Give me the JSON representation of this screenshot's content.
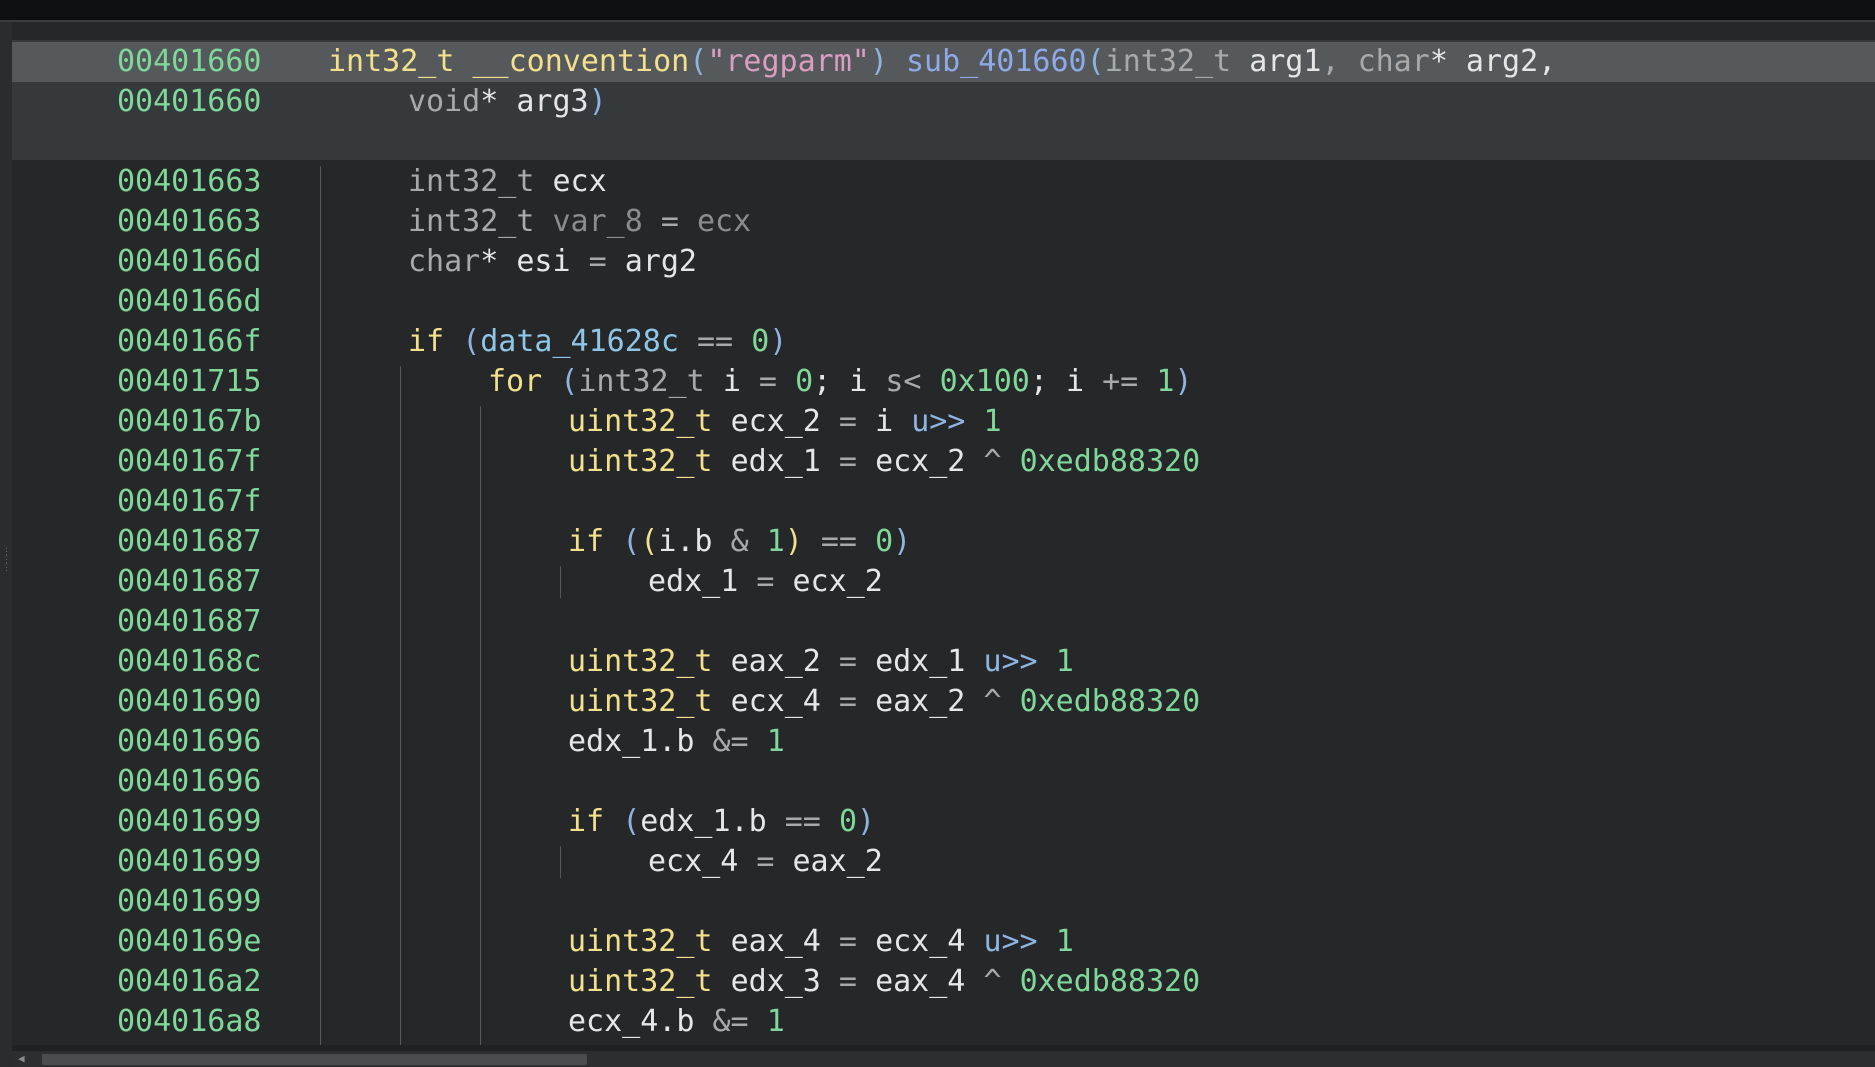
{
  "editor": {
    "lines": [
      {
        "addr": "00401660",
        "indent": 0,
        "tokens": [
          [
            "ytype",
            "int32_t "
          ],
          [
            "fname",
            "__convention"
          ],
          [
            "punc",
            "("
          ],
          [
            "str",
            "\"regparm\""
          ],
          [
            "punc",
            ") "
          ],
          [
            "func",
            "sub_401660"
          ],
          [
            "punc",
            "("
          ],
          [
            "type",
            "int32_t "
          ],
          [
            "var",
            "arg1"
          ],
          [
            "op",
            ", "
          ],
          [
            "type",
            "char"
          ],
          [
            "var",
            "* arg2,"
          ]
        ]
      },
      {
        "addr": "00401660",
        "indent": 1,
        "tokens": [
          [
            "type",
            "void"
          ],
          [
            "var",
            "* arg3"
          ],
          [
            "punc",
            ")"
          ]
        ]
      },
      {
        "addr": "",
        "indent": 0,
        "tokens": []
      },
      {
        "addr": "00401663",
        "indent": 1,
        "tokens": [
          [
            "type",
            "int32_t "
          ],
          [
            "var",
            "ecx"
          ]
        ]
      },
      {
        "addr": "00401663",
        "indent": 1,
        "tokens": [
          [
            "type",
            "int32_t "
          ],
          [
            "dim",
            "var_8"
          ],
          [
            "op",
            " = "
          ],
          [
            "dim",
            "ecx"
          ]
        ]
      },
      {
        "addr": "0040166d",
        "indent": 1,
        "tokens": [
          [
            "type",
            "char"
          ],
          [
            "var",
            "* esi"
          ],
          [
            "op",
            " = "
          ],
          [
            "var",
            "arg2"
          ]
        ]
      },
      {
        "addr": "0040166d",
        "indent": 1,
        "tokens": []
      },
      {
        "addr": "0040166f",
        "indent": 1,
        "tokens": [
          [
            "kw",
            "if "
          ],
          [
            "punc",
            "("
          ],
          [
            "data",
            "data_41628c"
          ],
          [
            "op",
            " == "
          ],
          [
            "num",
            "0"
          ],
          [
            "punc",
            ")"
          ]
        ]
      },
      {
        "addr": "00401715",
        "indent": 2,
        "tokens": [
          [
            "kw",
            "for "
          ],
          [
            "punc",
            "("
          ],
          [
            "type",
            "int32_t "
          ],
          [
            "var",
            "i"
          ],
          [
            "op",
            " = "
          ],
          [
            "num",
            "0"
          ],
          [
            "var",
            "; i "
          ],
          [
            "op",
            "s< "
          ],
          [
            "num",
            "0x100"
          ],
          [
            "var",
            "; i "
          ],
          [
            "op",
            "+= "
          ],
          [
            "num",
            "1"
          ],
          [
            "punc",
            ")"
          ]
        ]
      },
      {
        "addr": "0040167b",
        "indent": 3,
        "tokens": [
          [
            "ytype",
            "uint32_t "
          ],
          [
            "var",
            "ecx_2"
          ],
          [
            "op",
            " = "
          ],
          [
            "var",
            "i "
          ],
          [
            "punc",
            "u>> "
          ],
          [
            "num",
            "1"
          ]
        ]
      },
      {
        "addr": "0040167f",
        "indent": 3,
        "tokens": [
          [
            "ytype",
            "uint32_t "
          ],
          [
            "var",
            "edx_1"
          ],
          [
            "op",
            " = "
          ],
          [
            "var",
            "ecx_2 "
          ],
          [
            "op",
            "^ "
          ],
          [
            "num",
            "0xedb88320"
          ]
        ]
      },
      {
        "addr": "0040167f",
        "indent": 3,
        "tokens": []
      },
      {
        "addr": "00401687",
        "indent": 3,
        "tokens": [
          [
            "kw",
            "if "
          ],
          [
            "punc",
            "("
          ],
          [
            "pcall",
            "("
          ],
          [
            "var",
            "i.b "
          ],
          [
            "op",
            "& "
          ],
          [
            "num",
            "1"
          ],
          [
            "pcall",
            ")"
          ],
          [
            "op",
            " == "
          ],
          [
            "num",
            "0"
          ],
          [
            "punc",
            ")"
          ]
        ]
      },
      {
        "addr": "00401687",
        "indent": 4,
        "tokens": [
          [
            "var",
            "edx_1"
          ],
          [
            "op",
            " = "
          ],
          [
            "var",
            "ecx_2"
          ]
        ]
      },
      {
        "addr": "00401687",
        "indent": 3,
        "tokens": []
      },
      {
        "addr": "0040168c",
        "indent": 3,
        "tokens": [
          [
            "ytype",
            "uint32_t "
          ],
          [
            "var",
            "eax_2"
          ],
          [
            "op",
            " = "
          ],
          [
            "var",
            "edx_1 "
          ],
          [
            "punc",
            "u>> "
          ],
          [
            "num",
            "1"
          ]
        ]
      },
      {
        "addr": "00401690",
        "indent": 3,
        "tokens": [
          [
            "ytype",
            "uint32_t "
          ],
          [
            "var",
            "ecx_4"
          ],
          [
            "op",
            " = "
          ],
          [
            "var",
            "eax_2 "
          ],
          [
            "op",
            "^ "
          ],
          [
            "num",
            "0xedb88320"
          ]
        ]
      },
      {
        "addr": "00401696",
        "indent": 3,
        "tokens": [
          [
            "var",
            "edx_1.b "
          ],
          [
            "op",
            "&= "
          ],
          [
            "num",
            "1"
          ]
        ]
      },
      {
        "addr": "00401696",
        "indent": 3,
        "tokens": []
      },
      {
        "addr": "00401699",
        "indent": 3,
        "tokens": [
          [
            "kw",
            "if "
          ],
          [
            "punc",
            "("
          ],
          [
            "var",
            "edx_1.b"
          ],
          [
            "op",
            " == "
          ],
          [
            "num",
            "0"
          ],
          [
            "punc",
            ")"
          ]
        ]
      },
      {
        "addr": "00401699",
        "indent": 4,
        "tokens": [
          [
            "var",
            "ecx_4"
          ],
          [
            "op",
            " = "
          ],
          [
            "var",
            "eax_2"
          ]
        ]
      },
      {
        "addr": "00401699",
        "indent": 3,
        "tokens": []
      },
      {
        "addr": "0040169e",
        "indent": 3,
        "tokens": [
          [
            "ytype",
            "uint32_t "
          ],
          [
            "var",
            "eax_4"
          ],
          [
            "op",
            " = "
          ],
          [
            "var",
            "ecx_4 "
          ],
          [
            "punc",
            "u>> "
          ],
          [
            "num",
            "1"
          ]
        ]
      },
      {
        "addr": "004016a2",
        "indent": 3,
        "tokens": [
          [
            "ytype",
            "uint32_t "
          ],
          [
            "var",
            "edx_3"
          ],
          [
            "op",
            " = "
          ],
          [
            "var",
            "eax_4 "
          ],
          [
            "op",
            "^ "
          ],
          [
            "num",
            "0xedb88320"
          ]
        ]
      },
      {
        "addr": "004016a8",
        "indent": 3,
        "tokens": [
          [
            "var",
            "ecx_4.b "
          ],
          [
            "op",
            "&= "
          ],
          [
            "num",
            "1"
          ]
        ]
      }
    ]
  },
  "colors": {
    "address": "#7fd79a",
    "keyword": "#f2e08c",
    "function": "#8fa9e6",
    "string": "#d99fc1",
    "number": "#7fd79a",
    "data_symbol": "#8fc6e6",
    "background": "#252729"
  },
  "icons": {
    "splitter": "grip-icon",
    "scroll_left": "chevron-left-icon"
  }
}
